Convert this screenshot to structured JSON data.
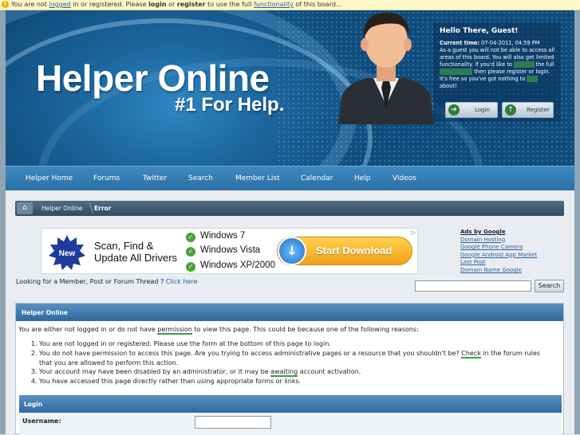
{
  "notice": {
    "p1": "You are not ",
    "l1": "logged",
    "p2": " in or registered. Please ",
    "b1": "login",
    "p3": " or ",
    "b2": "register",
    "p4": " to use the full ",
    "l2": "functionality",
    "p5": " of this board..."
  },
  "header": {
    "logo": "Helper Online",
    "tagline": "#1 For Help."
  },
  "guest": {
    "hello": "Hello There, Guest!",
    "time_label": "Current time:",
    "time_value": " 07-04-2011, 04:59 PM",
    "d1": "As a guest you will not be able to access all areas of this board. You will also get limited functionality. If you'd like to ",
    "h1": "register",
    "d2": " the full ",
    "h2": "functionality",
    "d3": " then please register or login. It's free so you've got nothing to ",
    "h3": "lose",
    "d4": " about!",
    "login": "Login",
    "register": "Register"
  },
  "nav": [
    "Helper Home",
    "Forums",
    "Twitter",
    "Search",
    "Member List",
    "Calendar",
    "Help",
    "Videos"
  ],
  "breadcrumb": {
    "home_icon": "home-icon",
    "crumb1": "Helper Online",
    "crumb2": "Error"
  },
  "ad": {
    "badge": "New",
    "headline1": "Scan, Find &",
    "headline2": "Update All Drivers",
    "os": [
      "Windows 7",
      "Windows Vista",
      "Windows XP/2000"
    ],
    "button": "Start Download"
  },
  "google_ads": {
    "header": "Ads by Google",
    "links": [
      "Domain Hosting",
      "Google Phone Camera",
      "Google Android App Market",
      "Last Post",
      "Domain Name Google"
    ]
  },
  "lookup": {
    "text": "Looking for a Member, Post or Forum Thread ? ",
    "link": "Click here"
  },
  "search": {
    "button": "Search",
    "value": ""
  },
  "panel": {
    "title": "Helper Online",
    "intro1": "You are either not logged in or do not have ",
    "intro_link": "permission",
    "intro2": " to view this page. This could be because one of the following reasons:",
    "r1": "You are not logged in or registered. Please use the form at the bottom of this page to login.",
    "r2a": "You do not have permission to access this page. Are you trying to access administrative pages or a resource that you shouldn't be? ",
    "r2_link": "Check",
    "r2b": " in the forum rules that you are allowed to perform this action.",
    "r3a": "Your account may have been disabled by an administrator, or it may be ",
    "r3_link": "awaiting",
    "r3b": " account activation.",
    "r4": "You have accessed this page directly rather than using appropriate forms or links.",
    "login_title": "Login",
    "username_label": "Username:",
    "username_value": ""
  },
  "colors": {
    "header_blue": "#1c679f",
    "nav_blue": "#2a6fa7",
    "link_blue": "#2a5ea0",
    "underline_green": "#3f9a4a",
    "notice_yellow": "#fcf7c8"
  }
}
